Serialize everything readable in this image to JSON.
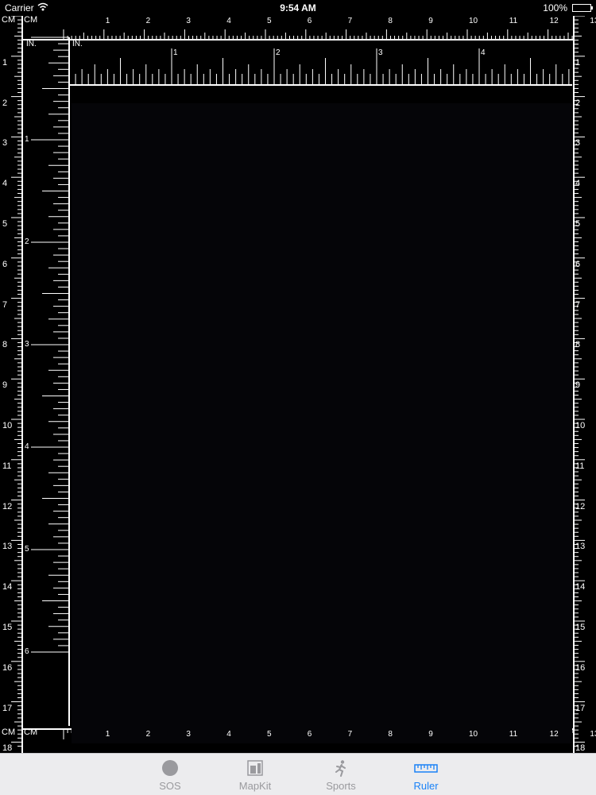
{
  "status_bar": {
    "carrier": "Carrier",
    "time": "9:54 AM",
    "battery": "100%"
  },
  "ruler": {
    "cm_unit_label": "CM",
    "in_unit_label": "IN.",
    "top_cm_ticks": [
      "1",
      "2",
      "3",
      "4",
      "5",
      "6",
      "7",
      "8",
      "9",
      "10",
      "11",
      "12",
      "13"
    ],
    "side_cm_ticks": [
      "1",
      "2",
      "3",
      "4",
      "5",
      "6",
      "7",
      "8",
      "9",
      "10",
      "11",
      "12",
      "13",
      "14",
      "15",
      "16",
      "17",
      "18"
    ],
    "top_in_ticks": [
      "1",
      "2",
      "3",
      "4"
    ],
    "side_in_ticks": [
      "1",
      "2",
      "3",
      "4",
      "5",
      "6"
    ]
  },
  "tab_bar": {
    "items": [
      {
        "label": "SOS",
        "icon": "circle-icon",
        "active": false
      },
      {
        "label": "MapKit",
        "icon": "map-icon",
        "active": false
      },
      {
        "label": "Sports",
        "icon": "runner-icon",
        "active": false
      },
      {
        "label": "Ruler",
        "icon": "ruler-icon",
        "active": true
      }
    ]
  },
  "colors": {
    "active_tab": "#1a82f7",
    "inactive_tab": "#9a9a9e",
    "ruler_background": "#000000",
    "tick": "#ffffff"
  }
}
